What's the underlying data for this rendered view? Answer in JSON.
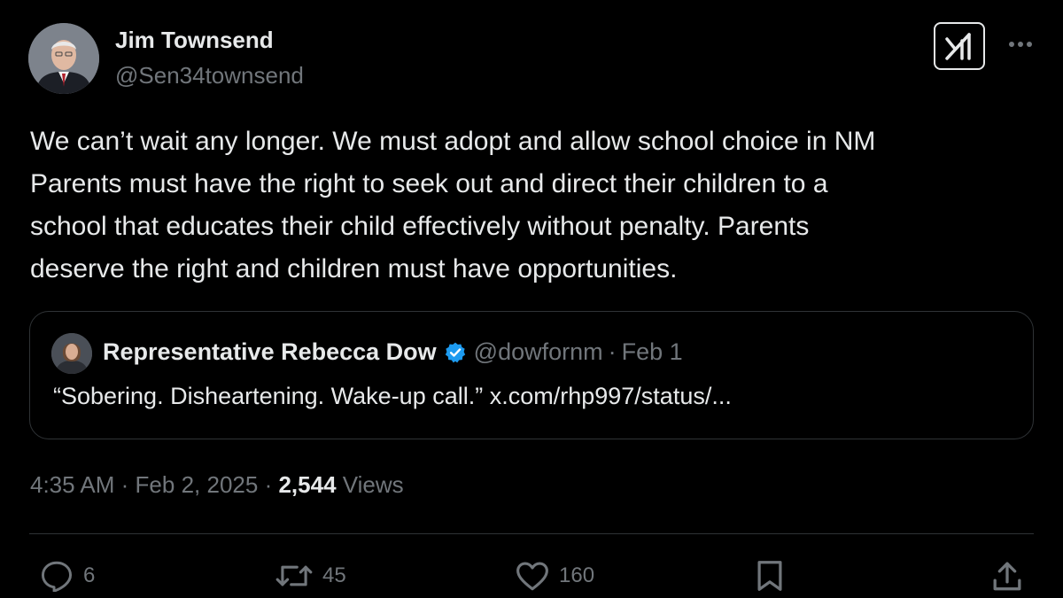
{
  "author": {
    "name": "Jim Townsend",
    "handle": "@Sen34townsend"
  },
  "tweet": {
    "text_lines": [
      "We can’t wait any longer. We must adopt and allow school choice in NM",
      "Parents must have the right to seek out and direct their children to a",
      "school that educates their child effectively without penalty. Parents",
      "deserve the right and children must have opportunities."
    ]
  },
  "quote": {
    "name": "Representative Rebecca Dow",
    "handle": "@dowfornm",
    "separator": "·",
    "date": "Feb 1",
    "text": "“Sobering. Disheartening. Wake-up call.” x.com/rhp997/status/..."
  },
  "meta": {
    "time": "4:35 AM",
    "sep1": "·",
    "date": "Feb 2, 2025",
    "sep2": "·",
    "views_count": "2,544",
    "views_label": "Views"
  },
  "actions": {
    "replies": "6",
    "reposts": "45",
    "likes": "160"
  },
  "icons": {
    "grok": "grok-icon",
    "more": "more-icon",
    "reply": "reply-icon",
    "repost": "repost-icon",
    "like": "like-icon",
    "bookmark": "bookmark-icon",
    "share": "share-icon",
    "verified": "verified-badge-icon"
  },
  "colors": {
    "background": "#000000",
    "text": "#e7e9ea",
    "muted": "#71767b",
    "border": "#2f3336",
    "verified": "#1d9bf0"
  }
}
